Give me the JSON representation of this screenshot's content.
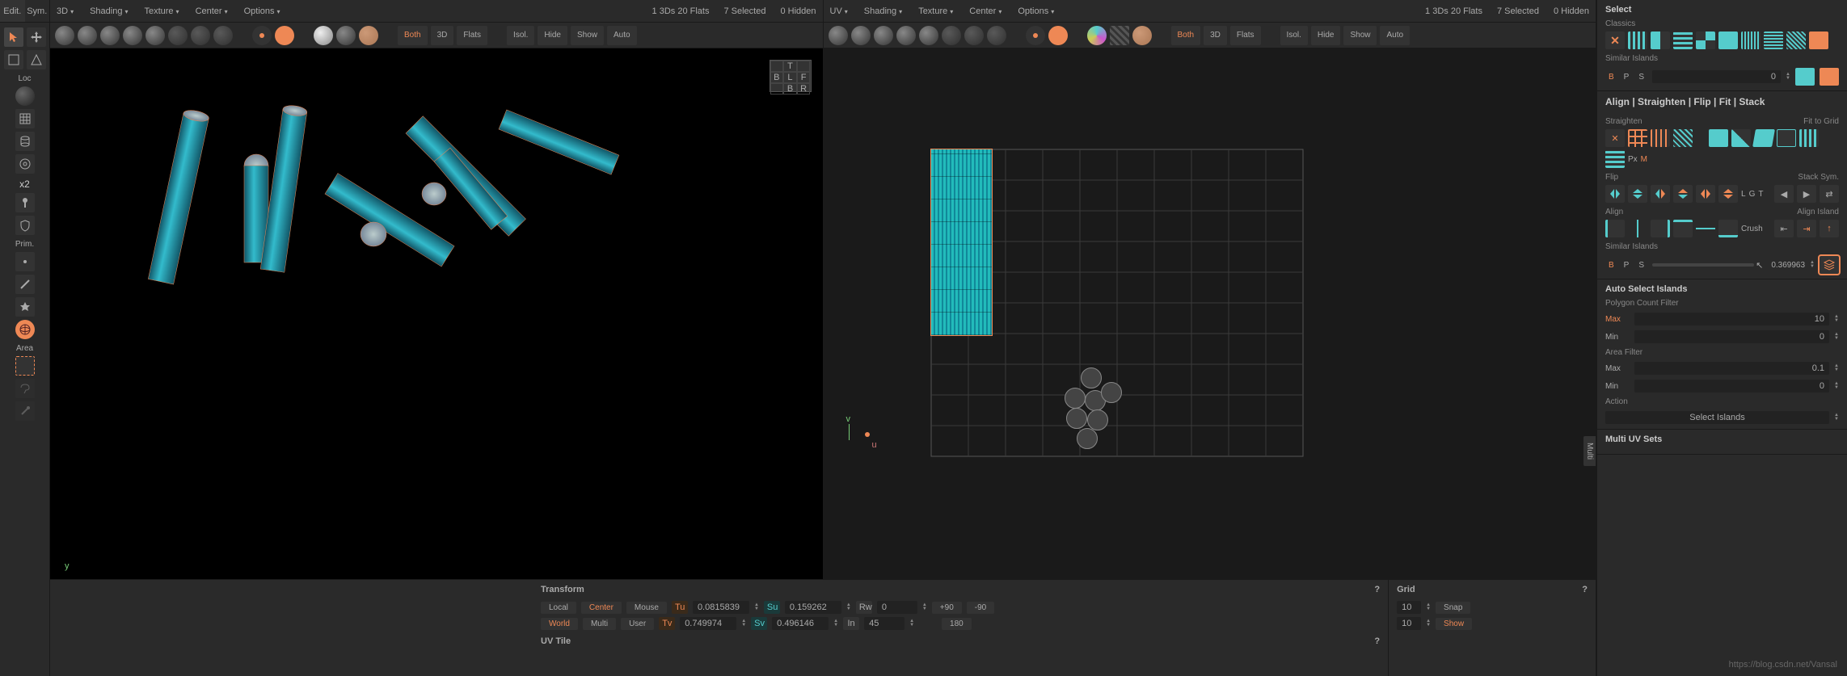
{
  "left_toolbar": {
    "tab1": "Edit.",
    "tab2": "Sym.",
    "loc_label": "Loc",
    "x2_label": "x2",
    "prim_label": "Prim.",
    "area_label": "Area"
  },
  "viewport_3d": {
    "header": {
      "mode": "3D",
      "shading": "Shading",
      "texture": "Texture",
      "center": "Center",
      "options": "Options"
    },
    "stats": {
      "counts": "1 3Ds 20 Flats",
      "selected": "7 Selected",
      "hidden": "0 Hidden"
    },
    "toolbar": {
      "both": "Both",
      "d3": "3D",
      "flats": "Flats",
      "isol": "Isol.",
      "hide": "Hide",
      "show": "Show",
      "auto": "Auto"
    },
    "nav": {
      "t": "T",
      "b": "B",
      "l": "L",
      "f": "F",
      "r": "R",
      "bb": "B"
    },
    "axis_y": "y"
  },
  "viewport_uv": {
    "header": {
      "mode": "UV",
      "shading": "Shading",
      "texture": "Texture",
      "center": "Center",
      "options": "Options"
    },
    "stats": {
      "counts": "1 3Ds 20 Flats",
      "selected": "7 Selected",
      "hidden": "0 Hidden"
    },
    "toolbar": {
      "both": "Both",
      "d3": "3D",
      "flats": "Flats",
      "isol": "Isol.",
      "hide": "Hide",
      "show": "Show",
      "auto": "Auto"
    },
    "axis_v": "v",
    "axis_u": "u"
  },
  "transform": {
    "title": "Transform",
    "local": "Local",
    "center": "Center",
    "mouse": "Mouse",
    "world": "World",
    "multi": "Multi",
    "user": "User",
    "tu": "Tu",
    "tu_val": "0.0815839",
    "tv": "Tv",
    "tv_val": "0.749974",
    "su": "Su",
    "su_val": "0.159262",
    "sv": "Sv",
    "sv_val": "0.496146",
    "rw": "Rw",
    "rw_val": "0",
    "in": "In",
    "in_val": "45",
    "p90": "+90",
    "n90": "-90",
    "r180": "180"
  },
  "grid": {
    "title": "Grid",
    "val1": "10",
    "val2": "10",
    "snap": "Snap",
    "show": "Show"
  },
  "uvtile": {
    "title": "UV Tile"
  },
  "multi_tab": "Multi",
  "right": {
    "select": {
      "title": "Select",
      "classics": "Classics",
      "similar": "Similar Islands",
      "b": "B",
      "p": "P",
      "s": "S",
      "val": "0"
    },
    "align": {
      "title": "Align | Straighten | Flip | Fit | Stack",
      "straighten": "Straighten",
      "fit_grid": "Fit to Grid",
      "px": "Px",
      "m": "M",
      "flip": "Flip",
      "stack_sym": "Stack Sym.",
      "l": "L",
      "g": "G",
      "t": "T",
      "align_label": "Align",
      "align_island": "Align Island",
      "crush": "Crush",
      "similar": "Similar Islands",
      "b": "B",
      "p": "P",
      "s": "S",
      "val": "0.369963"
    },
    "auto_select": {
      "title": "Auto Select Islands",
      "poly_filter": "Polygon Count Filter",
      "max": "Max",
      "max_val": "10",
      "min": "Min",
      "min_val": "0",
      "area_filter": "Area Filter",
      "amax": "Max",
      "amax_val": "0.1",
      "amin": "Min",
      "amin_val": "0",
      "action": "Action",
      "select_islands": "Select Islands"
    },
    "multi_uv": {
      "title": "Multi UV Sets"
    }
  },
  "watermark": "https://blog.csdn.net/Vansal"
}
